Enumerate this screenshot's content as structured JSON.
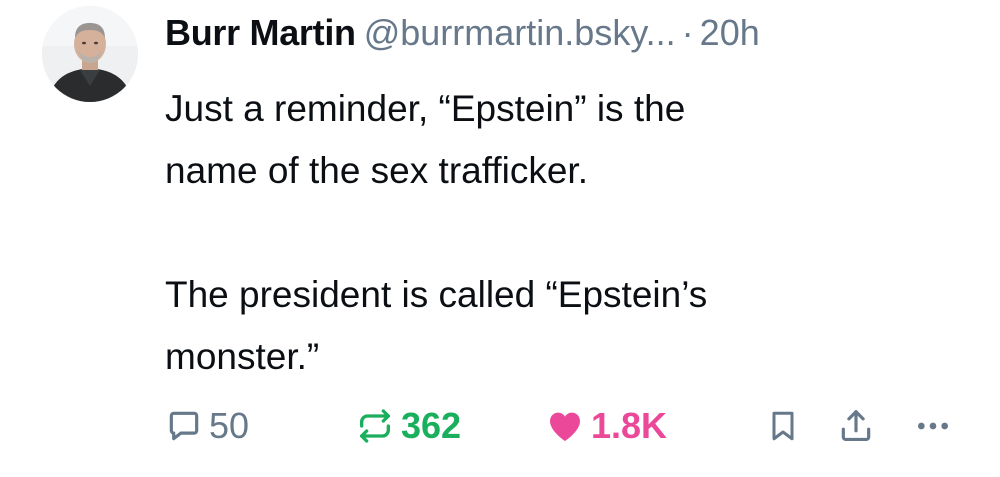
{
  "post": {
    "author_name": "Burr Martin",
    "author_handle": "@burrmartin.bsky...",
    "separator": "·",
    "timestamp": "20h",
    "text_paragraphs": [
      "Just a reminder, “Epstein” is the",
      "name of the sex trafficker.",
      "The president is called “Epstein’s",
      "monster.”"
    ],
    "reply_count": "50",
    "repost_count": "362",
    "like_count": "1.8K"
  },
  "colors": {
    "muted": "#66788a",
    "repost_active": "#1aaf5d",
    "like_active": "#ec4899",
    "text": "#0b0f14"
  },
  "icons": {
    "reply": "reply-icon",
    "repost": "repost-icon",
    "like": "heart-icon",
    "bookmark": "bookmark-icon",
    "share": "share-icon",
    "more": "more-icon"
  }
}
